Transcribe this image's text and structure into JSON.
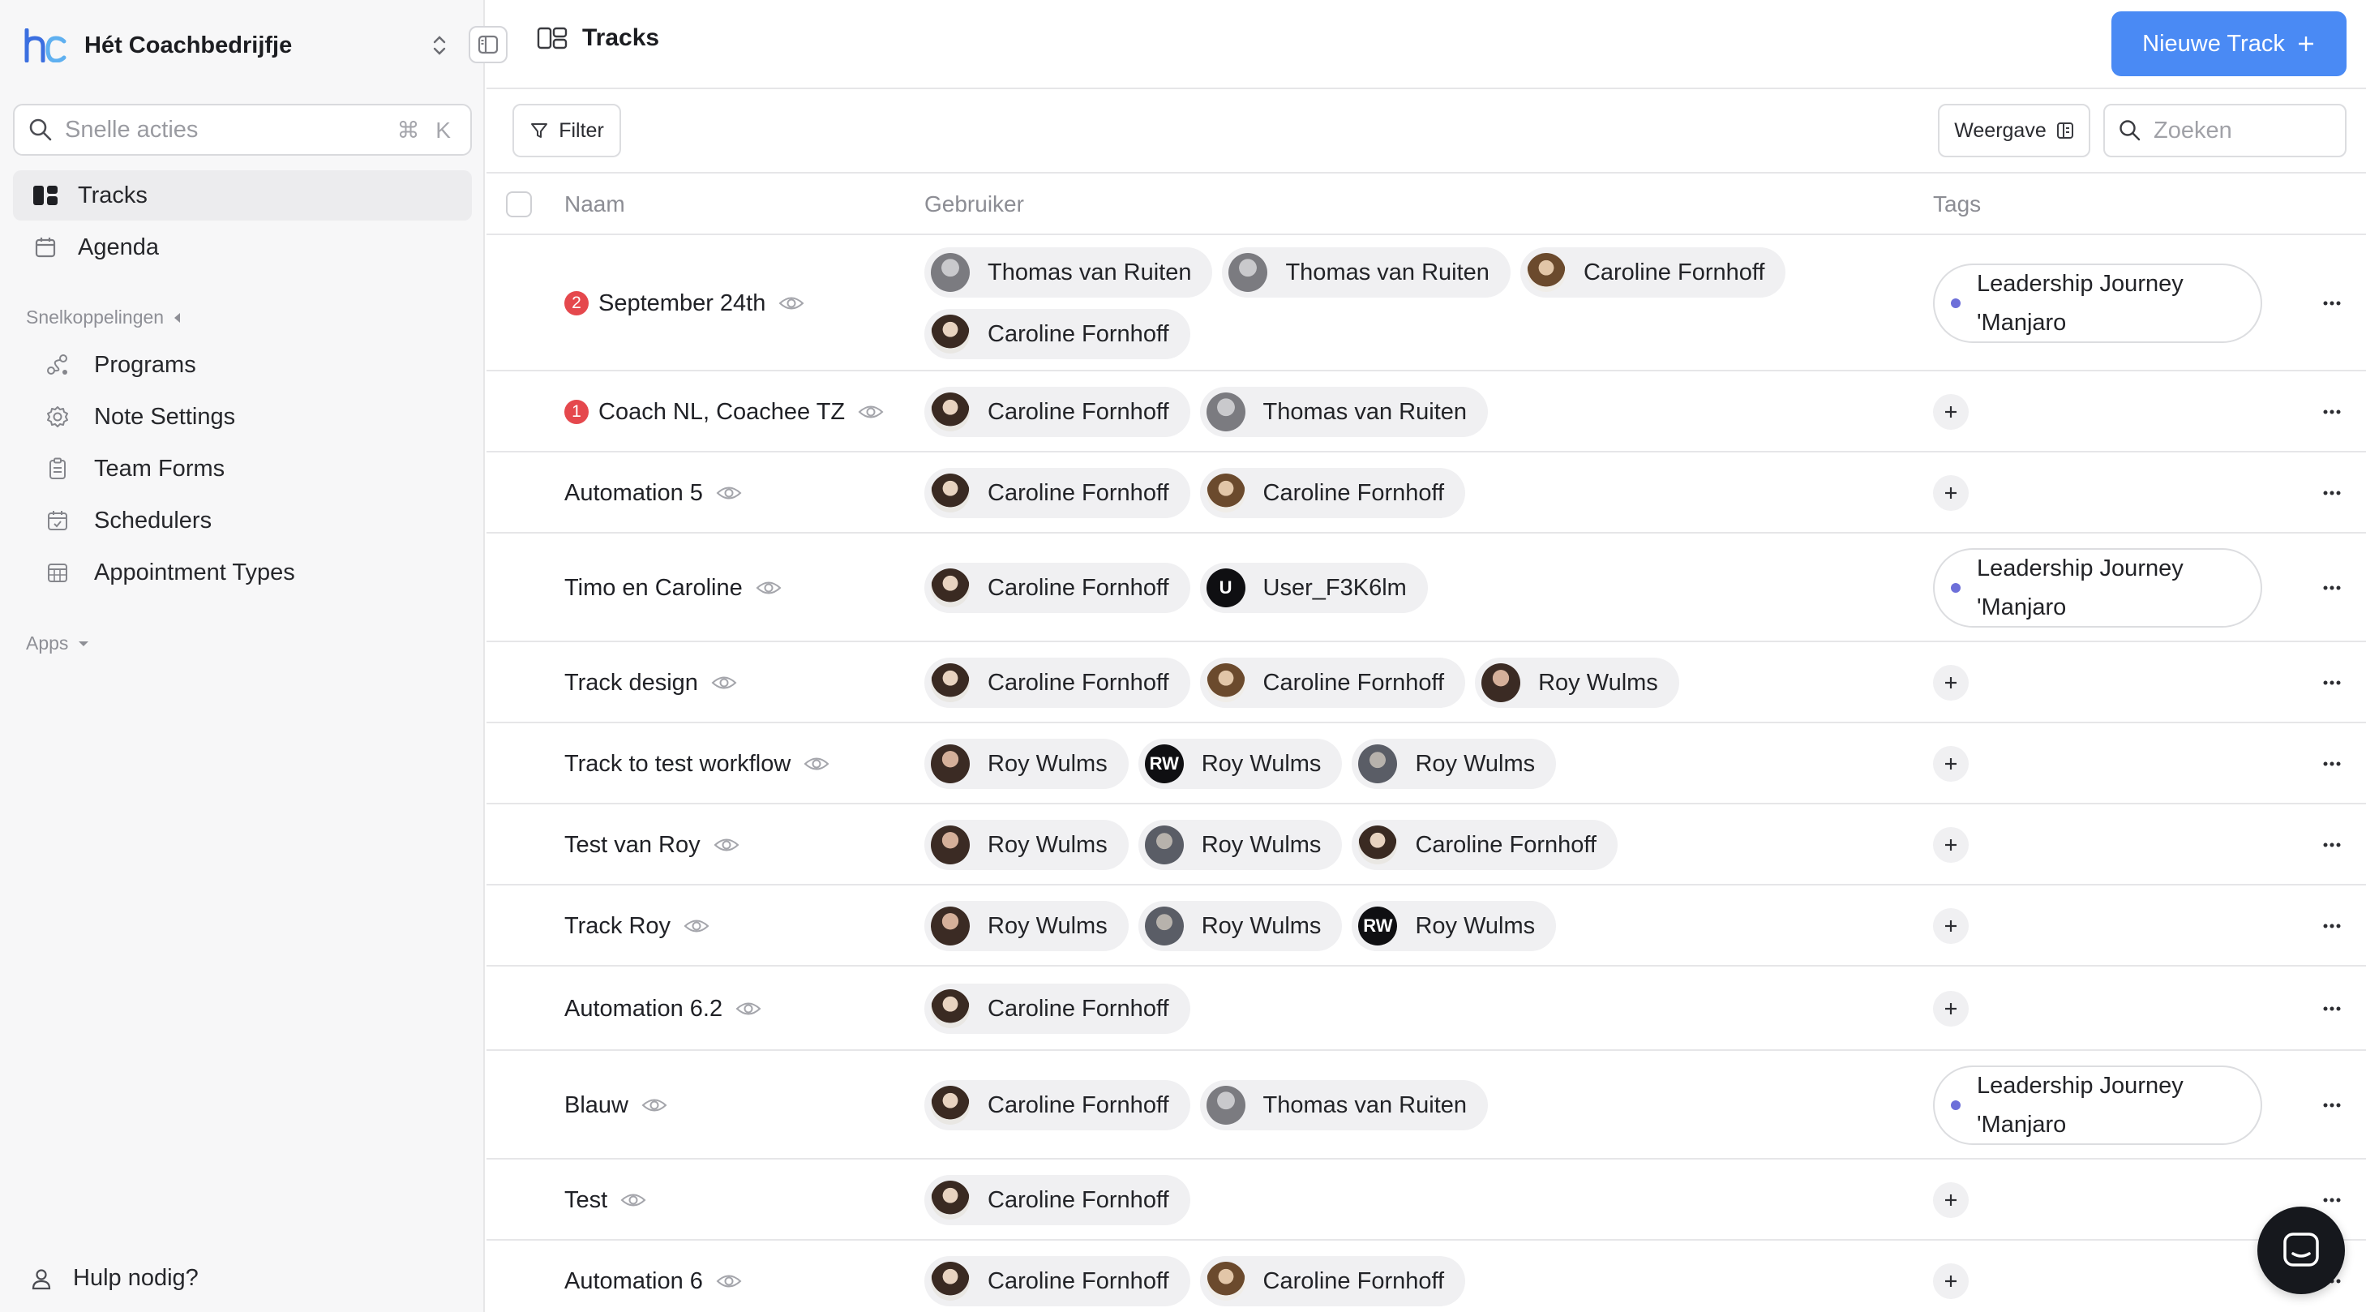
{
  "workspace": {
    "name": "Hét Coachbedrijfje"
  },
  "sidebar": {
    "quick_actions": {
      "placeholder": "Snelle acties",
      "shortcut": "⌘ K"
    },
    "nav": [
      {
        "label": "Tracks",
        "active": true
      },
      {
        "label": "Agenda"
      }
    ],
    "shortcuts_title": "Snelkoppelingen",
    "shortcuts": [
      {
        "label": "Programs",
        "icon": "programs-icon"
      },
      {
        "label": "Note Settings",
        "icon": "gear-icon"
      },
      {
        "label": "Team Forms",
        "icon": "clipboard-icon"
      },
      {
        "label": "Schedulers",
        "icon": "calendar-icon"
      },
      {
        "label": "Appointment Types",
        "icon": "grid-calendar-icon"
      }
    ],
    "apps_title": "Apps",
    "help": "Hulp nodig?"
  },
  "header": {
    "title": "Tracks",
    "new_button": "Nieuwe Track"
  },
  "toolbar": {
    "filter": "Filter",
    "view": "Weergave",
    "search_placeholder": "Zoeken"
  },
  "table": {
    "columns": {
      "name": "Naam",
      "users": "Gebruiker",
      "tags": "Tags"
    },
    "rows": [
      {
        "name": "September 24th",
        "badge": "2",
        "users": [
          [
            "Thomas van Ruiten",
            "g",
            ""
          ],
          [
            "Thomas van Ruiten",
            "g",
            ""
          ],
          [
            "Caroline Fornhoff",
            "c2",
            ""
          ],
          [
            "Caroline Fornhoff",
            "c",
            ""
          ]
        ],
        "tag": "Leadership Journey 'Manjaro"
      },
      {
        "name": "Coach NL, Coachee TZ",
        "badge": "1",
        "users": [
          [
            "Caroline Fornhoff",
            "c",
            ""
          ],
          [
            "Thomas van Ruiten",
            "g",
            ""
          ]
        ],
        "tag": ""
      },
      {
        "name": "Automation 5",
        "badge": "",
        "users": [
          [
            "Caroline Fornhoff",
            "c",
            ""
          ],
          [
            "Caroline Fornhoff",
            "c2",
            ""
          ]
        ],
        "tag": ""
      },
      {
        "name": "Timo en Caroline",
        "badge": "",
        "users": [
          [
            "Caroline Fornhoff",
            "c",
            ""
          ],
          [
            "User_F3K6lm",
            "b",
            "U"
          ]
        ],
        "tag": "Leadership Journey 'Manjaro"
      },
      {
        "name": "Track design",
        "badge": "",
        "users": [
          [
            "Caroline Fornhoff",
            "c",
            ""
          ],
          [
            "Caroline Fornhoff",
            "c2",
            ""
          ],
          [
            "Roy Wulms",
            "r",
            ""
          ]
        ],
        "tag": ""
      },
      {
        "name": "Track to test workflow",
        "badge": "",
        "users": [
          [
            "Roy Wulms",
            "r",
            ""
          ],
          [
            "Roy Wulms",
            "b",
            "RW"
          ],
          [
            "Roy Wulms",
            "r2",
            ""
          ]
        ],
        "tag": ""
      },
      {
        "name": "Test van Roy",
        "badge": "",
        "users": [
          [
            "Roy Wulms",
            "r",
            ""
          ],
          [
            "Roy Wulms",
            "r2",
            ""
          ],
          [
            "Caroline Fornhoff",
            "c",
            ""
          ]
        ],
        "tag": ""
      },
      {
        "name": "Track Roy",
        "badge": "",
        "users": [
          [
            "Roy Wulms",
            "r",
            ""
          ],
          [
            "Roy Wulms",
            "r2",
            ""
          ],
          [
            "Roy Wulms",
            "b",
            "RW"
          ]
        ],
        "tag": ""
      },
      {
        "name": "Automation 6.2",
        "badge": "",
        "users": [
          [
            "Caroline Fornhoff",
            "c",
            ""
          ]
        ],
        "tag": ""
      },
      {
        "name": "Blauw",
        "badge": "",
        "users": [
          [
            "Caroline Fornhoff",
            "c",
            ""
          ],
          [
            "Thomas van Ruiten",
            "g",
            ""
          ]
        ],
        "tag": "Leadership Journey 'Manjaro"
      },
      {
        "name": "Test",
        "badge": "",
        "users": [
          [
            "Caroline Fornhoff",
            "c",
            ""
          ]
        ],
        "tag": ""
      },
      {
        "name": "Automation 6",
        "badge": "",
        "users": [
          [
            "Caroline Fornhoff",
            "c",
            ""
          ],
          [
            "Caroline Fornhoff",
            "c2",
            ""
          ]
        ],
        "tag": ""
      }
    ]
  },
  "colors": {
    "accent": "#4a8af4",
    "badge": "#e5484d",
    "tag_dot": "#6d6fd9"
  }
}
